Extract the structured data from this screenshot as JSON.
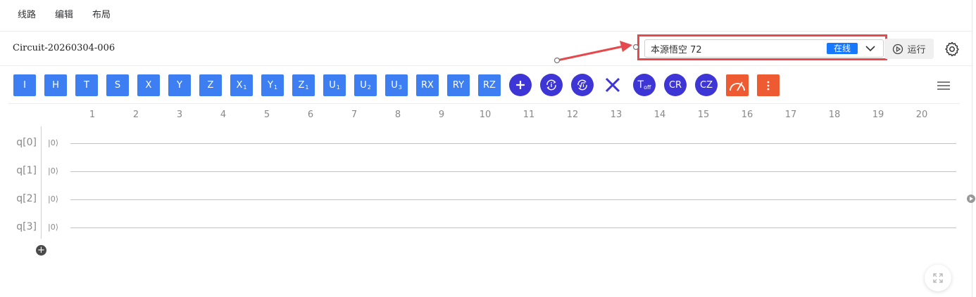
{
  "menu": {
    "items": [
      "线路",
      "编辑",
      "布局"
    ]
  },
  "header": {
    "circuit_name": "Circuit-20260304-006",
    "backend": {
      "value": "本源悟空 72",
      "status": "在线"
    },
    "run_label": "运行"
  },
  "toolbar": {
    "gates": [
      "I",
      "H",
      "T",
      "S",
      "X",
      "Y",
      "Z"
    ],
    "gates_sub": [
      {
        "base": "X",
        "sub": "1"
      },
      {
        "base": "Y",
        "sub": "1"
      },
      {
        "base": "Z",
        "sub": "1"
      },
      {
        "base": "U",
        "sub": "1"
      },
      {
        "base": "U",
        "sub": "2"
      },
      {
        "base": "U",
        "sub": "3"
      }
    ],
    "rot": [
      "RX",
      "RY",
      "RZ"
    ],
    "toffoli": {
      "base": "T",
      "sub": "off"
    },
    "cr": "CR",
    "cz": "CZ"
  },
  "columns": [
    "1",
    "2",
    "3",
    "4",
    "5",
    "6",
    "7",
    "8",
    "9",
    "10",
    "11",
    "12",
    "13",
    "14",
    "15",
    "16",
    "17",
    "18",
    "19",
    "20"
  ],
  "qubits": [
    "q[0]",
    "q[1]",
    "q[2]",
    "q[3]"
  ],
  "init_state": "|0⟩",
  "colors": {
    "gate": "#3d7ef2",
    "control_gate": "#3d35d6",
    "special_gate": "#ee5a32",
    "badge": "#1677ff",
    "highlight": "#e5484d"
  }
}
